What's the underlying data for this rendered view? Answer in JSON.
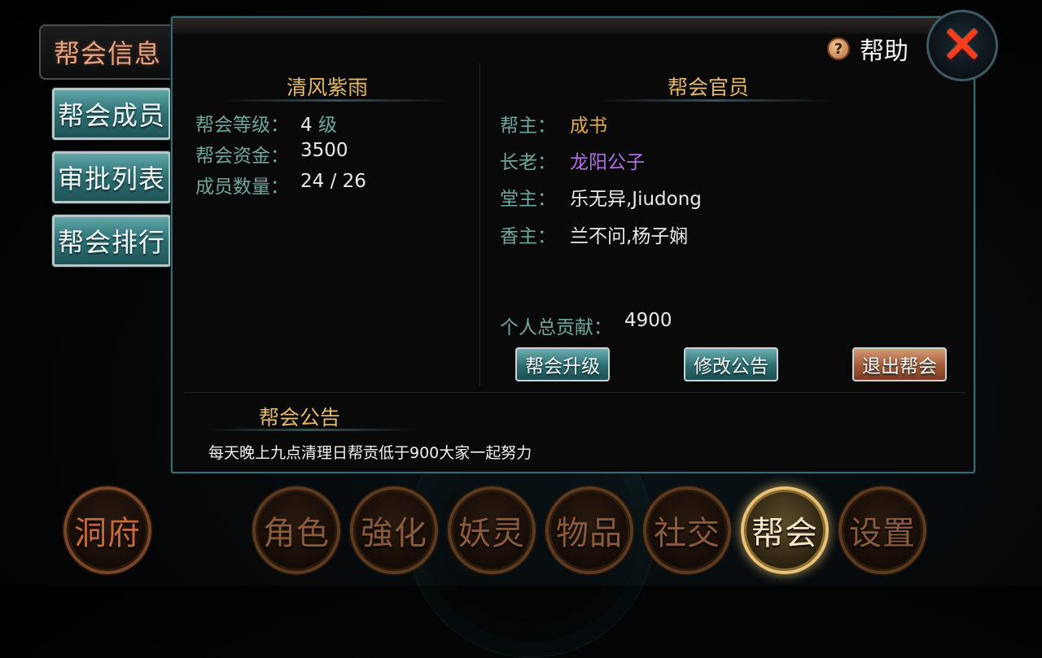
{
  "tabs": {
    "active": "帮会信息",
    "items": [
      "帮会成员",
      "审批列表",
      "帮会排行"
    ]
  },
  "help": {
    "label": "帮助",
    "icon": "question-icon"
  },
  "close": {
    "icon": "close-x-icon",
    "glyph": "✕"
  },
  "guild": {
    "name": "清风紫雨",
    "level_label": "帮会等级：",
    "level_value": "4",
    "level_unit": "级",
    "funds_label": "帮会资金：",
    "funds_value": "3500",
    "members_label": "成员数量：",
    "members_value": "24 / 26"
  },
  "officers": {
    "title": "帮会官员",
    "leader_label": "帮主：",
    "leader_value": "成书",
    "elder_label": "长老：",
    "elder_value": "龙阳公子",
    "hall_label": "堂主：",
    "hall_value": "乐无异,Jiudong",
    "incense_label": "香主：",
    "incense_value": "兰不问,杨子娴"
  },
  "contribution": {
    "label": "个人总贡献：",
    "value": "4900"
  },
  "actions": {
    "upgrade": "帮会升级",
    "edit_notice": "修改公告",
    "quit": "退出帮会"
  },
  "notice": {
    "title": "帮会公告",
    "text": "每天晚上九点清理日帮贡低于900大家一起努力"
  },
  "nav": {
    "dongfu": "洞府",
    "role": "角色",
    "enhance": "強化",
    "spirit": "妖灵",
    "items": "物品",
    "social": "社交",
    "guild": "帮会",
    "settings": "设置"
  },
  "colors": {
    "accent_gold": "#e4b86a",
    "label_teal": "#6fa7a0",
    "leader_gold": "#e8ad3a",
    "elder_purple": "#b46ce8"
  }
}
